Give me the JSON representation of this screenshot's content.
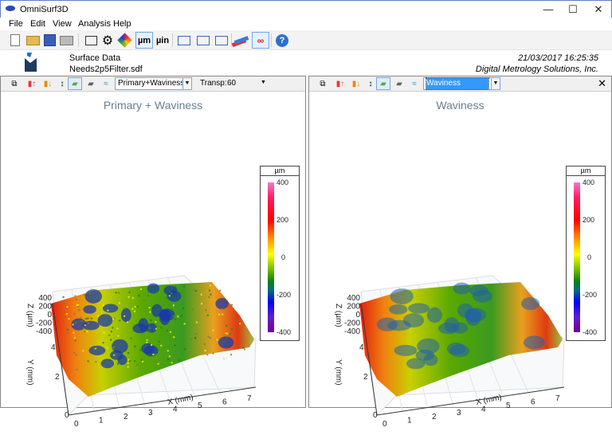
{
  "window": {
    "title": "OmniSurf3D",
    "minimize": "—",
    "maximize": "☐",
    "close": "✕"
  },
  "menu": [
    "File",
    "Edit",
    "View",
    "Analysis",
    "Help"
  ],
  "toolbar": {
    "units_um": "µm",
    "units_uin": "µin",
    "selected": [
      "µm",
      "link"
    ]
  },
  "info": {
    "label": "Surface Data",
    "file": "Needs2p5Filter.sdf",
    "datetime": "21/03/2017  16:25:35",
    "company": "Digital Metrology Solutions, Inc."
  },
  "left_panel": {
    "view_select": "Primary+Waviness",
    "transp_label": "Transp:",
    "transp_value": "60",
    "plot_title": "Primary + Waviness"
  },
  "right_panel": {
    "view_select": "Waviness",
    "close": "✕",
    "plot_title": "Waviness"
  },
  "axes": {
    "z_label": "Z (µm)",
    "y_label": "Y (mm)",
    "x_label": "X (mm)",
    "z_ticks": [
      "400",
      "200",
      "0",
      "-200",
      "-400"
    ],
    "y_ticks": [
      "0",
      "2",
      "4"
    ],
    "x_ticks": [
      "0",
      "1",
      "2",
      "3",
      "4",
      "5",
      "6",
      "7"
    ]
  },
  "colorbar": {
    "unit": "µm",
    "ticks": [
      "400",
      "200",
      "0",
      "-200",
      "-400"
    ],
    "range": [
      -400,
      400
    ],
    "colors": [
      "#ee7ad0",
      "#ff0000",
      "#ffff00",
      "#108010",
      "#0000ff",
      "#700090"
    ]
  }
}
